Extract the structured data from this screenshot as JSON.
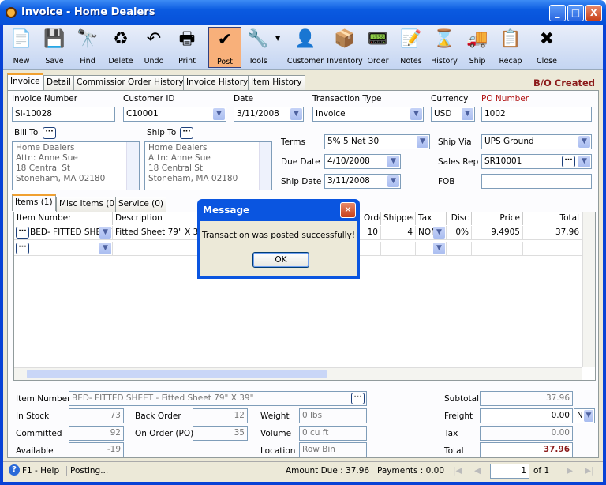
{
  "window": {
    "title": "Invoice - Home Dealers",
    "minimize": "_",
    "maximize": "□",
    "close": "X"
  },
  "toolbar": [
    {
      "label": "New",
      "icon": "new-document-icon",
      "glyph": "📄"
    },
    {
      "label": "Save",
      "icon": "floppy-disk-icon",
      "glyph": "💾"
    },
    {
      "label": "Find",
      "icon": "binoculars-icon",
      "glyph": "🔭"
    },
    {
      "label": "Delete",
      "icon": "recycle-bin-icon",
      "glyph": "♻"
    },
    {
      "label": "Undo",
      "icon": "undo-arrow-icon",
      "glyph": "↶"
    },
    {
      "label": "Print",
      "icon": "printer-icon",
      "glyph": "🖶"
    },
    {
      "label": "Post",
      "icon": "post-checkmark-icon",
      "glyph": "✔"
    },
    {
      "label": "Tools",
      "icon": "tools-icon",
      "glyph": "🔧"
    },
    {
      "label": "Customer",
      "icon": "customer-person-icon",
      "glyph": "👤"
    },
    {
      "label": "Inventory",
      "icon": "boxes-icon",
      "glyph": "📦"
    },
    {
      "label": "Order",
      "icon": "handheld-order-icon",
      "glyph": "📟"
    },
    {
      "label": "Notes",
      "icon": "notepad-icon",
      "glyph": "📝"
    },
    {
      "label": "History",
      "icon": "history-hourglass-icon",
      "glyph": "⌛"
    },
    {
      "label": "Ship",
      "icon": "forklift-icon",
      "glyph": "🚚"
    },
    {
      "label": "Recap",
      "icon": "recap-document-icon",
      "glyph": "📋"
    },
    {
      "label": "Close",
      "icon": "close-window-icon",
      "glyph": "✖"
    }
  ],
  "tabs": [
    "Invoice",
    "Detail",
    "Commission",
    "Order History",
    "Invoice History",
    "Item History"
  ],
  "status_badge": "B/O Created",
  "header": {
    "invoice_number_label": "Invoice Number",
    "invoice_number": "SI-10028",
    "customer_id_label": "Customer ID",
    "customer_id": "C10001",
    "date_label": "Date",
    "date": "3/11/2008",
    "transaction_type_label": "Transaction Type",
    "transaction_type": "Invoice",
    "currency_label": "Currency",
    "currency": "USD",
    "po_number_label": "PO Number",
    "po_number": "1002",
    "bill_to_label": "Bill To",
    "bill_to": [
      "Home Dealers",
      "Attn: Anne Sue",
      "18 Central St",
      "Stoneham, MA 02180"
    ],
    "ship_to_label": "Ship To",
    "ship_to": [
      "Home Dealers",
      "Attn: Anne Sue",
      "18 Central St",
      "Stoneham, MA 02180"
    ],
    "terms_label": "Terms",
    "terms": "5% 5 Net 30",
    "due_date_label": "Due Date",
    "due_date": "4/10/2008",
    "ship_date_label": "Ship Date",
    "ship_date": "3/11/2008",
    "ship_via_label": "Ship Via",
    "ship_via": "UPS Ground",
    "sales_rep_label": "Sales Rep",
    "sales_rep": "SR10001",
    "fob_label": "FOB",
    "fob": ""
  },
  "item_tabs": [
    "Items (1)",
    "Misc Items (0)",
    "Service (0)"
  ],
  "grid": {
    "columns": [
      "Item Number",
      "Description",
      "Ordered",
      "Shipped",
      "Tax",
      "Disc",
      "Price",
      "Total"
    ],
    "rows": [
      {
        "item": "BED- FITTED SHEET",
        "description": "Fitted Sheet 79\" X 39\"",
        "ordered": "10",
        "shipped": "4",
        "tax": "NON",
        "disc": "0%",
        "price": "9.4905",
        "total": "37.96"
      }
    ]
  },
  "dialog": {
    "title": "Message",
    "message": "Transaction was posted successfully!",
    "ok": "OK"
  },
  "details": {
    "item_number_label": "Item Number",
    "item_number": "BED- FITTED SHEET - Fitted Sheet 79\" X 39\"",
    "in_stock_label": "In Stock",
    "in_stock": "73",
    "committed_label": "Committed",
    "committed": "92",
    "available_label": "Available",
    "available": "-19",
    "back_order_label": "Back Order",
    "back_order": "12",
    "on_order_label": "On Order (PO)",
    "on_order": "35",
    "weight_label": "Weight",
    "weight": "0 lbs",
    "volume_label": "Volume",
    "volume": "0 cu ft",
    "location_label": "Location",
    "location": "Row  Bin"
  },
  "totals": {
    "subtotal_label": "Subtotal",
    "subtotal": "37.96",
    "freight_label": "Freight",
    "freight": "0.00",
    "freight_code": "N",
    "tax_label": "Tax",
    "tax": "0.00",
    "total_label": "Total",
    "total": "37.96",
    "total_color": "#8b1a1a"
  },
  "statusbar": {
    "help": "F1 - Help",
    "status": "Posting...",
    "amount_due": "Amount Due : 37.96",
    "payments": "Payments : 0.00",
    "page": "1",
    "of": "of  1"
  }
}
